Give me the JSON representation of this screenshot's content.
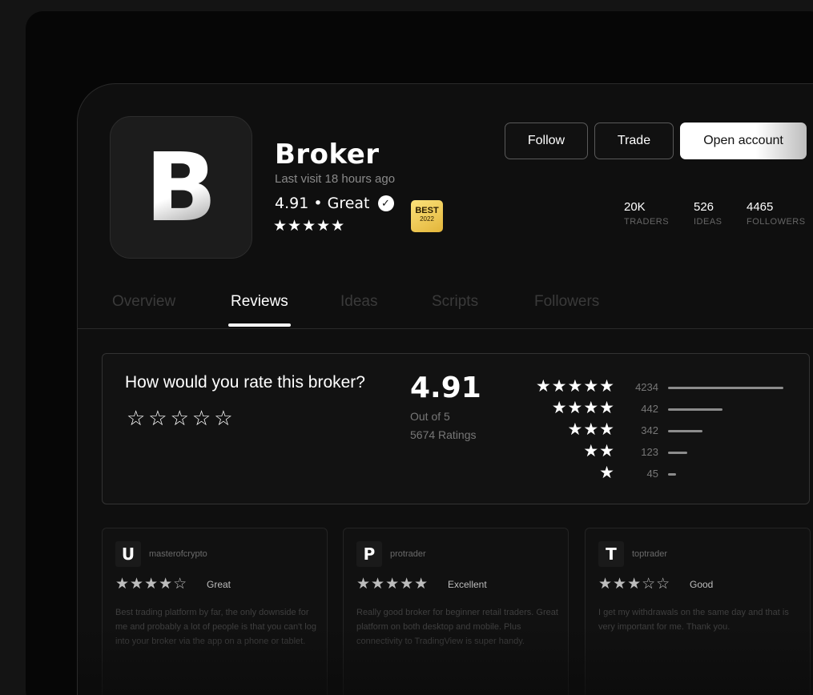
{
  "profile": {
    "logo_letter": "B",
    "name": "Broker",
    "last_visit": "Last visit 18 hours ago",
    "rating_text": "4.91 • Great",
    "stars": "★★★★★",
    "badge_top": "BEST",
    "badge_year": "2022"
  },
  "actions": {
    "follow": "Follow",
    "trade": "Trade",
    "open_account": "Open account"
  },
  "stats": [
    {
      "value": "20K",
      "label": "TRADERS"
    },
    {
      "value": "526",
      "label": "IDEAS"
    },
    {
      "value": "4465",
      "label": "FOLLOWERS"
    }
  ],
  "tabs": [
    {
      "label": "Overview",
      "active": false
    },
    {
      "label": "Reviews",
      "active": true
    },
    {
      "label": "Ideas",
      "active": false
    },
    {
      "label": "Scripts",
      "active": false
    },
    {
      "label": "Followers",
      "active": false
    }
  ],
  "rate": {
    "question": "How would you rate this broker?",
    "empty_stars": "☆☆☆☆☆",
    "average": "4.91",
    "out_of": "Out of 5",
    "total": "5674 Ratings"
  },
  "distribution": [
    {
      "stars": "★★★★★",
      "count": "4234",
      "fill": 1.0
    },
    {
      "stars": "★★★★",
      "count": "442",
      "fill": 0.47
    },
    {
      "stars": "★★★",
      "count": "342",
      "fill": 0.3
    },
    {
      "stars": "★★",
      "count": "123",
      "fill": 0.17
    },
    {
      "stars": "★",
      "count": "45",
      "fill": 0.07
    }
  ],
  "reviews": [
    {
      "initial": "U",
      "user": "masterofcrypto",
      "stars": "★★★★☆",
      "word": "Great",
      "text": "Best trading platform by far, the only downside for me and probably a lot of people is that you can't log into your broker via the app on a phone or tablet."
    },
    {
      "initial": "P",
      "user": "protrader",
      "stars": "★★★★★",
      "word": "Excellent",
      "text": "Really good broker for beginner retail traders. Great platform on both desktop and mobile. Plus connectivity to TradingView is super handy."
    },
    {
      "initial": "T",
      "user": "toptrader",
      "stars": "★★★☆☆",
      "word": "Good",
      "text": "I get my withdrawals on the same day and that is very important for me. Thank you."
    }
  ]
}
